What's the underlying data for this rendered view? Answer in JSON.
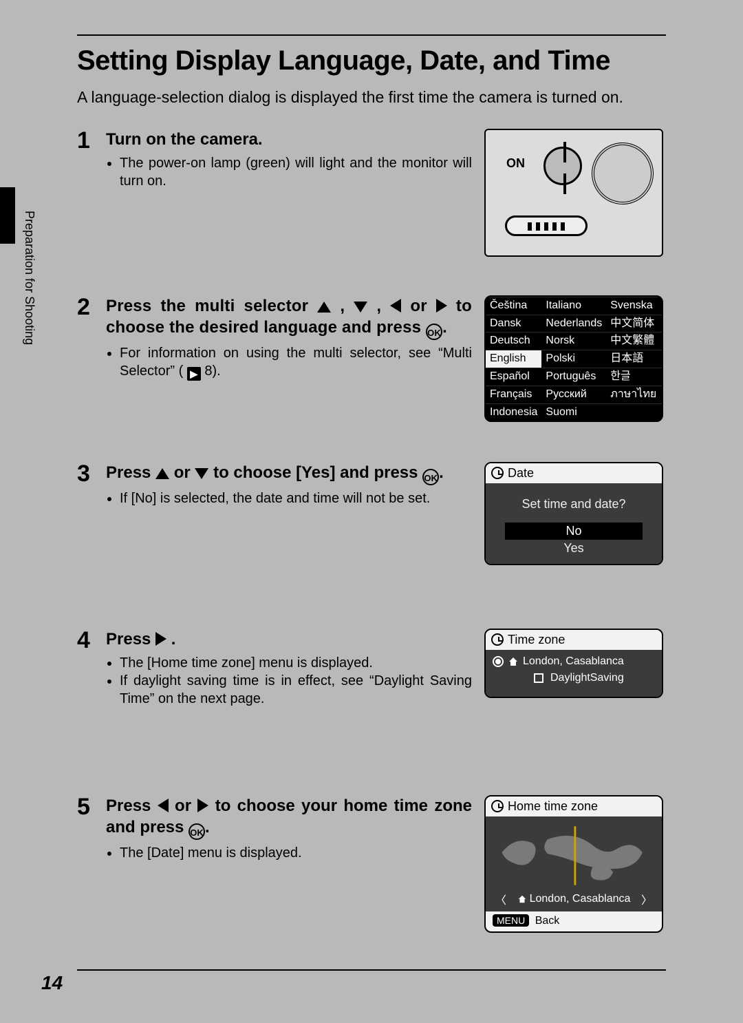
{
  "page_number": "14",
  "side_label": "Preparation for Shooting",
  "title": "Setting Display Language, Date, and Time",
  "intro": "A language-selection dialog is displayed the first time the camera is turned on.",
  "icons": {
    "ok": "OK",
    "xref": "▶"
  },
  "steps": [
    {
      "num": "1",
      "title": "Turn on the camera.",
      "bullets": [
        "The power-on lamp (green) will light and the monitor will turn on."
      ],
      "fig_camera": {
        "on": "ON"
      }
    },
    {
      "num": "2",
      "title_pre": "Press the multi selector ",
      "title_mid1": ", ",
      "title_mid2": ", ",
      "title_mid3": " or ",
      "title_post": " to choose the desired language and press ",
      "bullets": [
        "For information on using the multi selector, see “Multi Selector” ("
      ],
      "xref_page": " 8).",
      "fig_lang": {
        "languages": [
          [
            "Čeština",
            "Italiano",
            "Svenska"
          ],
          [
            "Dansk",
            "Nederlands",
            "中文简体"
          ],
          [
            "Deutsch",
            "Norsk",
            "中文繁體"
          ],
          [
            "English",
            "Polski",
            "日本語"
          ],
          [
            "Español",
            "Português",
            "한글"
          ],
          [
            "Français",
            "Русский",
            "ภาษาไทย"
          ],
          [
            "Indonesia",
            "Suomi",
            ""
          ]
        ],
        "selected": "English"
      }
    },
    {
      "num": "3",
      "title_pre": "Press ",
      "title_mid": " or ",
      "title_post": " to choose [Yes] and press ",
      "bullets": [
        "If [No] is selected, the date and time will not be set."
      ],
      "fig_date": {
        "hdr": "Date",
        "q": "Set time and date?",
        "no": "No",
        "yes": "Yes"
      }
    },
    {
      "num": "4",
      "title_pre": "Press ",
      "title_post": " .",
      "bullets": [
        "The [Home time zone] menu is displayed.",
        "If daylight saving time is in effect, see “Daylight Saving Time” on the next page."
      ],
      "fig_tz": {
        "hdr": "Time zone",
        "item": "London, Casablanca",
        "ds": "DaylightSaving"
      }
    },
    {
      "num": "5",
      "title_pre": "Press ",
      "title_mid": " or ",
      "title_post": "  to choose your home time zone and press ",
      "bullets": [
        "The [Date] menu is displayed."
      ],
      "fig_home": {
        "hdr": "Home time zone",
        "tz": "London, Casablanca",
        "menu": "MENU",
        "back": "Back"
      }
    }
  ]
}
